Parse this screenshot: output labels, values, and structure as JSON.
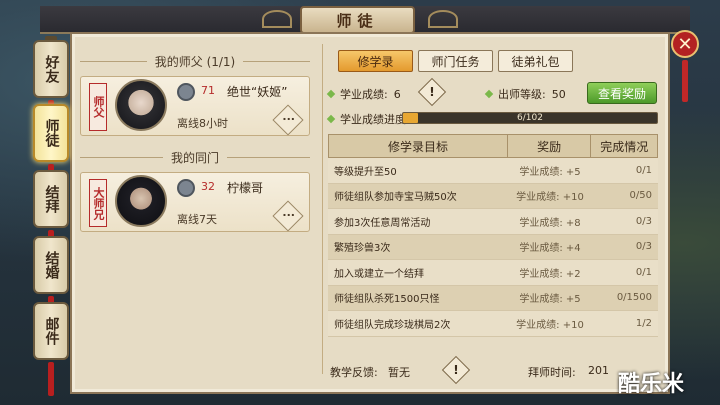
{
  "window": {
    "title": "师徒"
  },
  "side_tabs": [
    {
      "label": "好友",
      "active": false
    },
    {
      "label": "师徒",
      "active": true
    },
    {
      "label": "结拜",
      "active": false
    },
    {
      "label": "结婚",
      "active": false
    },
    {
      "label": "邮件",
      "active": false
    }
  ],
  "master_section": {
    "title": "我的师父 (1/1)",
    "seal": "师父",
    "level": "71",
    "name": "绝世“妖姬”",
    "status": "离线8小时",
    "more": "···"
  },
  "peers_section": {
    "title": "我的同门",
    "seal": "大师兄",
    "level": "32",
    "name": "柠檬哥",
    "status": "离线7天",
    "more": "···"
  },
  "tabs": [
    {
      "label": "修学录",
      "active": true
    },
    {
      "label": "师门任务",
      "active": false
    },
    {
      "label": "徒弟礼包",
      "active": false
    }
  ],
  "stats": {
    "score_label": "学业成绩:",
    "score_value": "6",
    "grad_label": "出师等级:",
    "grad_value": "50",
    "view_reward": "查看奖励",
    "progress_label": "学业成绩进度:",
    "progress_text": "6/102",
    "progress_fraction": 0.059
  },
  "table": {
    "headers": [
      "修学录目标",
      "奖励",
      "完成情况"
    ],
    "rows": [
      {
        "goal": "等级提升至50",
        "reward": "学业成绩: +5",
        "status": "0/1"
      },
      {
        "goal": "师徒组队参加寺宝马贼50次",
        "reward": "学业成绩: +10",
        "status": "0/50"
      },
      {
        "goal": "参加3次任意周常活动",
        "reward": "学业成绩: +8",
        "status": "0/3"
      },
      {
        "goal": "繁殖珍兽3次",
        "reward": "学业成绩: +4",
        "status": "0/3"
      },
      {
        "goal": "加入或建立一个结拜",
        "reward": "学业成绩: +2",
        "status": "0/1"
      },
      {
        "goal": "师徒组队杀死1500只怪",
        "reward": "学业成绩: +5",
        "status": "0/1500"
      },
      {
        "goal": "师徒组队完成珍珑棋局2次",
        "reward": "学业成绩: +10",
        "status": "1/2"
      }
    ]
  },
  "footer": {
    "feedback_label": "教学反馈:",
    "feedback_value": "暂无",
    "date_label": "拜师时间:",
    "date_value": "201"
  },
  "watermark": "酷乐米",
  "colors": {
    "accent": "#e49a2e",
    "danger": "#b52b2b",
    "green": "#4d9a2a"
  }
}
